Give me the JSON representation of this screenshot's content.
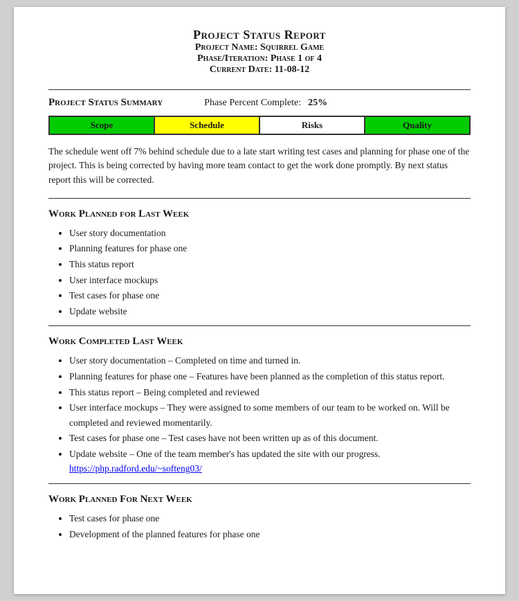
{
  "header": {
    "title": "Project Status Report",
    "line1": "Project Name: Squirrel Game",
    "line2": "Phase/Iteration: Phase 1 of 4",
    "line3": "Current Date: 11-08-12"
  },
  "status_summary": {
    "label": "Project Status Summary",
    "phase_percent_label": "Phase Percent Complete:",
    "phase_percent_value": "25%"
  },
  "status_bar": {
    "items": [
      {
        "label": "Scope",
        "color": "green"
      },
      {
        "label": "Schedule",
        "color": "yellow"
      },
      {
        "label": "Risks",
        "color": "white"
      },
      {
        "label": "Quality",
        "color": "green"
      }
    ]
  },
  "description": "The schedule went off 7% behind schedule due to a late start writing test cases and planning for phase one of the project. This is being corrected by having more team contact to get the work done promptly. By next status report this will be corrected.",
  "work_planned_last_week": {
    "heading": "Work Planned for Last Week",
    "items": [
      "User story documentation",
      "Planning features for phase one",
      "This status report",
      "User interface mockups",
      "Test cases for phase one",
      "Update website"
    ]
  },
  "work_completed_last_week": {
    "heading": "Work Completed Last Week",
    "items": [
      "User story documentation – Completed on time and turned in.",
      "Planning features for phase one – Features have been planned as the completion of this status report.",
      "This status report – Being completed and reviewed",
      "User interface mockups – They were assigned to some members of our team to be worked on. Will be completed and reviewed momentarily.",
      "Test cases for phase one – Test cases have not been written up as of this document.",
      "Update website – One of the team member's has updated the site with our progress. https://php.radford.edu/~softeng03/"
    ]
  },
  "work_planned_next_week": {
    "heading": "Work Planned For Next Week",
    "items": [
      "Test cases for phase one",
      "Development of the planned features for phase one"
    ]
  }
}
